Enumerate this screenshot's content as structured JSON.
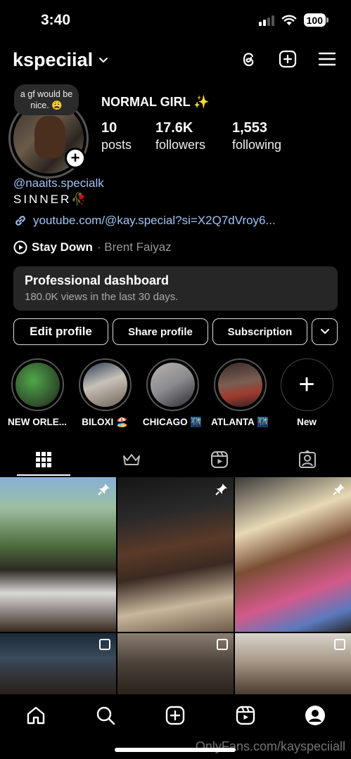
{
  "status_bar": {
    "time": "3:40",
    "battery": "100"
  },
  "header": {
    "username": "kspeciial"
  },
  "note": {
    "text": "a gf would be nice. 😩"
  },
  "profile": {
    "name": "NORMAL GIRL ✨",
    "stats": [
      {
        "value": "10",
        "label": "posts"
      },
      {
        "value": "17.6K",
        "label": "followers"
      },
      {
        "value": "1,553",
        "label": "following"
      }
    ],
    "handle": "@naaits.specialk",
    "bio": "SINNER🥀",
    "link": "youtube.com/@kay.special?si=X2Q7dVroy6...",
    "music": {
      "title": "Stay Down",
      "artist": "· Brent Faiyaz"
    }
  },
  "dashboard": {
    "title": "Professional dashboard",
    "subtitle": "180.0K views in the last 30 days."
  },
  "actions": {
    "edit": "Edit profile",
    "share": "Share profile",
    "subscription": "Subscription"
  },
  "highlights": [
    {
      "label": "NEW ORLE...",
      "color": "#3f6b3a"
    },
    {
      "label": "BILOXI 🏖️",
      "color": "#6e6258"
    },
    {
      "label": "CHICAGO 🌃",
      "color": "#8a8a90"
    },
    {
      "label": "ATLANTA 🌃",
      "color": "#5a4a44"
    },
    {
      "label": "New",
      "color": ""
    }
  ],
  "colors": {
    "link": "#9fc3f5",
    "card": "#262626"
  },
  "watermark": "OnlyFans.com/kayspeciiall"
}
